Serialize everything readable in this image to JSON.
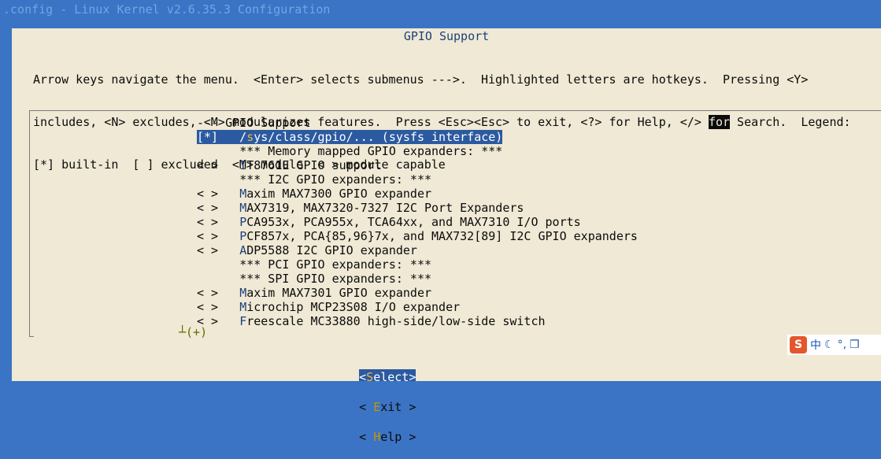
{
  "window": {
    "title": ".config - Linux Kernel v2.6.35.3 Configuration"
  },
  "dialog": {
    "title": "GPIO Support",
    "help_lines": [
      "Arrow keys navigate the menu.  <Enter> selects submenus --->.  Highlighted letters are hotkeys.  Pressing <Y>",
      "includes, <N> excludes, <M> modularizes features.  Press <Esc><Esc> to exit, <?> for Help, </> ",
      "for",
      " Search.  Legend:",
      "[*] built-in  [ ] excluded  <M> module  < > module capable"
    ]
  },
  "menu": {
    "items": [
      {
        "prefix": "--- ",
        "hotkey": "",
        "rest": "GPIO Support"
      },
      {
        "prefix": "[*]   /",
        "hotkey": "s",
        "rest": "ys/class/gpio/... (sysfs interface)"
      },
      {
        "prefix": "      ",
        "hotkey": "",
        "rest": "*** Memory mapped GPIO expanders: ***"
      },
      {
        "prefix": "< >   ",
        "hotkey": "I",
        "rest": "T8761E GPIO support"
      },
      {
        "prefix": "      ",
        "hotkey": "",
        "rest": "*** I2C GPIO expanders: ***"
      },
      {
        "prefix": "< >   ",
        "hotkey": "M",
        "rest": "axim MAX7300 GPIO expander"
      },
      {
        "prefix": "< >   ",
        "hotkey": "M",
        "rest": "AX7319, MAX7320-7327 I2C Port Expanders"
      },
      {
        "prefix": "< >   ",
        "hotkey": "P",
        "rest": "CA953x, PCA955x, TCA64xx, and MAX7310 I/O ports"
      },
      {
        "prefix": "< >   ",
        "hotkey": "P",
        "rest": "CF857x, PCA{85,96}7x, and MAX732[89] I2C GPIO expanders"
      },
      {
        "prefix": "< >   ",
        "hotkey": "A",
        "rest": "DP5588 I2C GPIO expander"
      },
      {
        "prefix": "      ",
        "hotkey": "",
        "rest": "*** PCI GPIO expanders: ***"
      },
      {
        "prefix": "      ",
        "hotkey": "",
        "rest": "*** SPI GPIO expanders: ***"
      },
      {
        "prefix": "< >   ",
        "hotkey": "M",
        "rest": "axim MAX7301 GPIO expander"
      },
      {
        "prefix": "< >   ",
        "hotkey": "M",
        "rest": "icrochip MCP23S08 I/O expander"
      },
      {
        "prefix": "< >   ",
        "hotkey": "F",
        "rest": "reescale MC33880 high-side/low-side switch"
      }
    ],
    "more_indicator": "┴(+)"
  },
  "buttons": {
    "select": {
      "left": "<",
      "hotkey": "S",
      "rest": "elect>"
    },
    "exit": {
      "left": "< ",
      "hotkey": "E",
      "rest": "xit >"
    },
    "help": {
      "left": "< ",
      "hotkey": "H",
      "rest": "elp >"
    }
  },
  "ime": {
    "logo": "S",
    "lang": "中",
    "icons": [
      "moon-icon",
      "punctuation-icon",
      "window-icon"
    ]
  },
  "colors": {
    "background": "#3b74c4",
    "dialog": "#efe9d5",
    "selection": "#2c5aa0",
    "hotkey": "#1f3f7a"
  }
}
